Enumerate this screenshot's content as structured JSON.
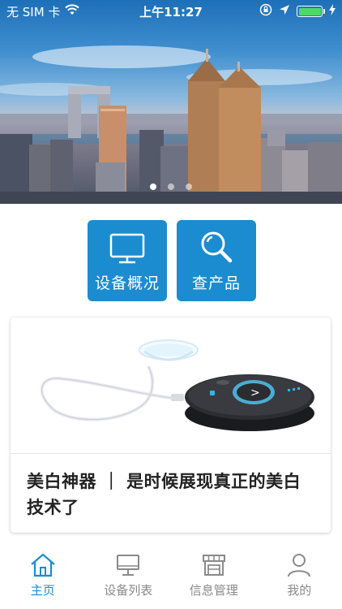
{
  "status_bar": {
    "carrier": "无 SIM 卡",
    "time": "上午11:27",
    "battery_color": "#4cd964"
  },
  "banner": {
    "image": "city-skyline",
    "slide_count": 3,
    "active_slide": 1
  },
  "quick_actions": [
    {
      "label": "设备概况",
      "icon": "monitor-icon"
    },
    {
      "label": "查产品",
      "icon": "search-icon"
    }
  ],
  "product_card": {
    "image": "whitening-device",
    "title": "美白神器 ｜ 是时候展现真正的美白技术了"
  },
  "tab_bar": {
    "active_color": "#1b8ccf",
    "inactive_color": "#8a8a8a",
    "tabs": [
      {
        "label": "主页",
        "icon": "home-icon",
        "active": true
      },
      {
        "label": "设备列表",
        "icon": "monitor-icon",
        "active": false
      },
      {
        "label": "信息管理",
        "icon": "store-icon",
        "active": false
      },
      {
        "label": "我的",
        "icon": "user-icon",
        "active": false
      }
    ]
  }
}
